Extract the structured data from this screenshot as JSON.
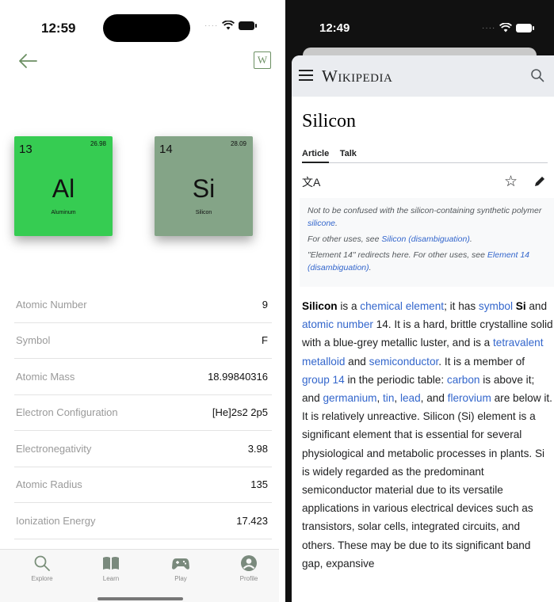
{
  "left": {
    "status": {
      "time": "12:59"
    },
    "header": {
      "back_icon": "arrow-left-icon",
      "wiki_button": "W"
    },
    "elements": [
      {
        "number": "13",
        "mass": "26.98",
        "symbol": "Al",
        "name": "Aluminum",
        "color": "#36cc52"
      },
      {
        "number": "14",
        "mass": "28.09",
        "symbol": "Si",
        "name": "Silicon",
        "color": "#84a487"
      }
    ],
    "properties": [
      {
        "label": "Atomic Number",
        "value": "9"
      },
      {
        "label": "Symbol",
        "value": "F"
      },
      {
        "label": "Atomic Mass",
        "value": "18.99840316"
      },
      {
        "label": "Electron Configuration",
        "value": "[He]2s2 2p5"
      },
      {
        "label": "Electronegativity",
        "value": "3.98"
      },
      {
        "label": "Atomic Radius",
        "value": "135"
      },
      {
        "label": "Ionization Energy",
        "value": "17.423"
      }
    ],
    "tabs": [
      {
        "label": "Explore",
        "icon": "search-icon"
      },
      {
        "label": "Learn",
        "icon": "book-icon"
      },
      {
        "label": "Play",
        "icon": "gamepad-icon"
      },
      {
        "label": "Profile",
        "icon": "profile-icon"
      }
    ]
  },
  "right": {
    "status": {
      "time": "12:49"
    },
    "header": {
      "logo": "Wikipedia"
    },
    "article": {
      "title": "Silicon",
      "tabs": [
        "Article",
        "Talk"
      ],
      "hatnotes": {
        "h1_text": "Not to be confused with the silicon-containing synthetic polymer ",
        "h1_link": "silicone",
        "h1_end": ".",
        "h2_text": "For other uses, see ",
        "h2_link": "Silicon (disambiguation)",
        "h2_end": ".",
        "h3_text": "\"Element 14\" redirects here. For other uses, see ",
        "h3_link": "Element 14 (disambiguation)",
        "h3_end": "."
      },
      "body": {
        "t1": "Silicon",
        "t2": " is a ",
        "l1": "chemical element",
        "t3": "; it has ",
        "l2": "symbol",
        "t4": " ",
        "t5": "Si",
        "t6": " and ",
        "l3": "atomic number",
        "t7": " 14. It is a hard, brittle crystalline solid with a blue-grey metallic luster, and is a ",
        "l4": "tetravalent",
        "t8": " ",
        "l5": "metalloid",
        "t9": " and ",
        "l6": "semiconductor",
        "t10": ". It is a member of ",
        "l7": "group 14",
        "t11": " in the periodic table: ",
        "l8": "carbon",
        "t12": " is above it; and ",
        "l9": "germanium",
        "t13": ", ",
        "l10": "tin",
        "t14": ", ",
        "l11": "lead",
        "t15": ", and ",
        "l12": "flerovium",
        "t16": " are below it. It is relatively unreactive. Silicon (Si) element is a significant element that is essential for several physiological and metabolic processes in plants. Si is widely regarded as the predominant semiconductor material due to its versatile applications in various electrical devices such as transistors, solar cells, integrated circuits, and others. These may be due to its significant band gap, expansive"
      }
    }
  }
}
